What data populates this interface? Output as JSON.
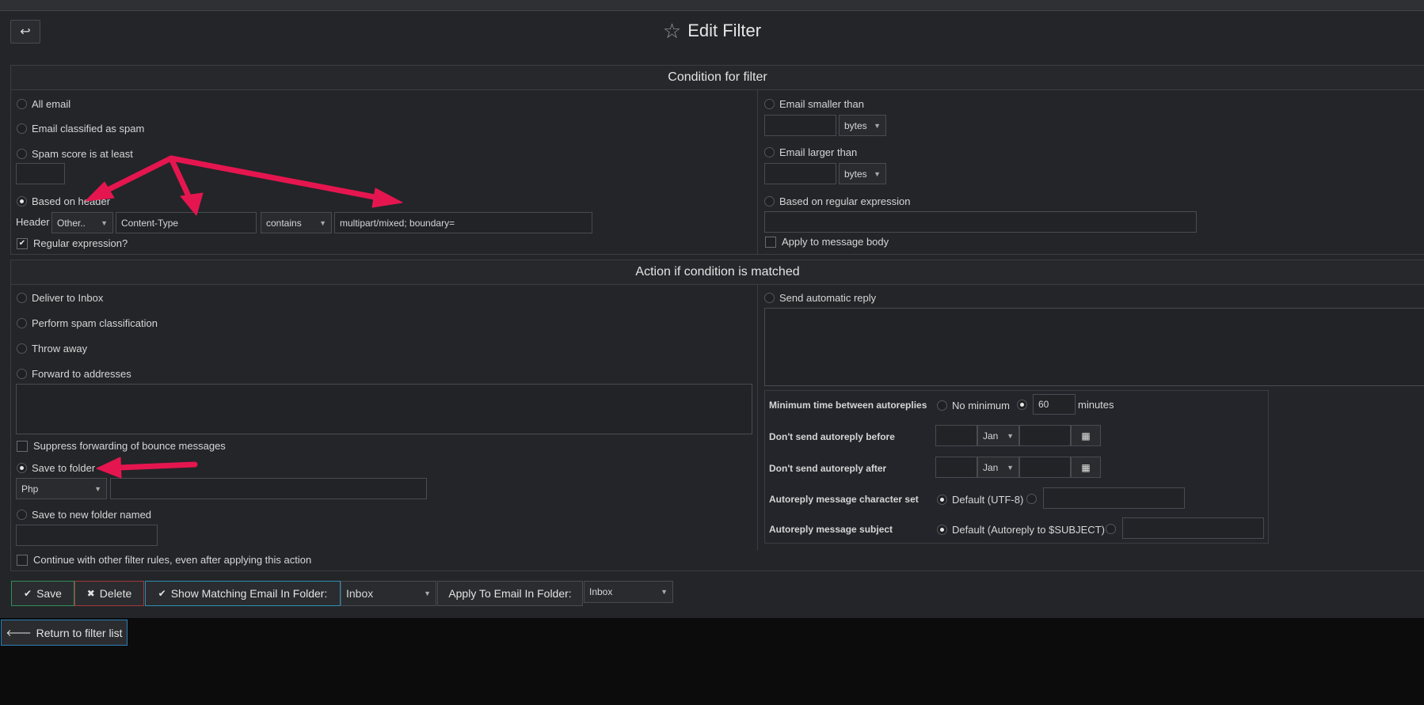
{
  "header": {
    "title": "Edit Filter",
    "back_icon": "↩",
    "star_icon": "☆"
  },
  "condition": {
    "heading": "Condition for filter",
    "all_email": "All email",
    "classified_spam": "Email classified as spam",
    "spam_score": "Spam score is at least",
    "spam_score_value": "",
    "based_on_header": "Based on header",
    "header_label": "Header",
    "header_select": "Other..",
    "header_name": "Content-Type",
    "operator": "contains",
    "header_value": "multipart/mixed; boundary=",
    "regex_check": "Regular expression?",
    "email_smaller": "Email smaller than",
    "email_larger": "Email larger than",
    "unit": "bytes",
    "based_on_regex": "Based on regular expression",
    "apply_body": "Apply to message body"
  },
  "action": {
    "heading": "Action if condition is matched",
    "deliver_inbox": "Deliver to Inbox",
    "spam_class": "Perform spam classification",
    "throw_away": "Throw away",
    "forward": "Forward to addresses",
    "suppress_bounce": "Suppress forwarding of bounce messages",
    "save_folder": "Save to folder",
    "folder_select": "Php",
    "save_new_folder": "Save to new folder named",
    "continue_rules": "Continue with other filter rules, even after applying this action",
    "auto_reply": "Send automatic reply",
    "min_time": "Minimum time between autoreplies",
    "no_minimum": "No minimum",
    "minutes_value": "60",
    "minutes": "minutes",
    "not_before": "Don't send autoreply before",
    "not_after": "Don't send autoreply after",
    "month": "Jan",
    "charset_label": "Autoreply message character set",
    "charset_default": "Default (UTF-8)",
    "subject_label": "Autoreply message subject",
    "subject_default": "Default (Autoreply to $SUBJECT)"
  },
  "footer": {
    "save": "Save",
    "delete": "Delete",
    "show_matching": "Show Matching Email In Folder:",
    "show_folder": "Inbox",
    "apply_to": "Apply To Email In Folder:",
    "apply_folder": "Inbox",
    "return_list": "Return to filter list"
  },
  "colors": {
    "annotation_arrow": "#e5164f",
    "save_border": "#2f8f5a",
    "delete_border": "#a03a3a",
    "show_border": "#2b8fb3",
    "return_border": "#2b7fb3"
  }
}
